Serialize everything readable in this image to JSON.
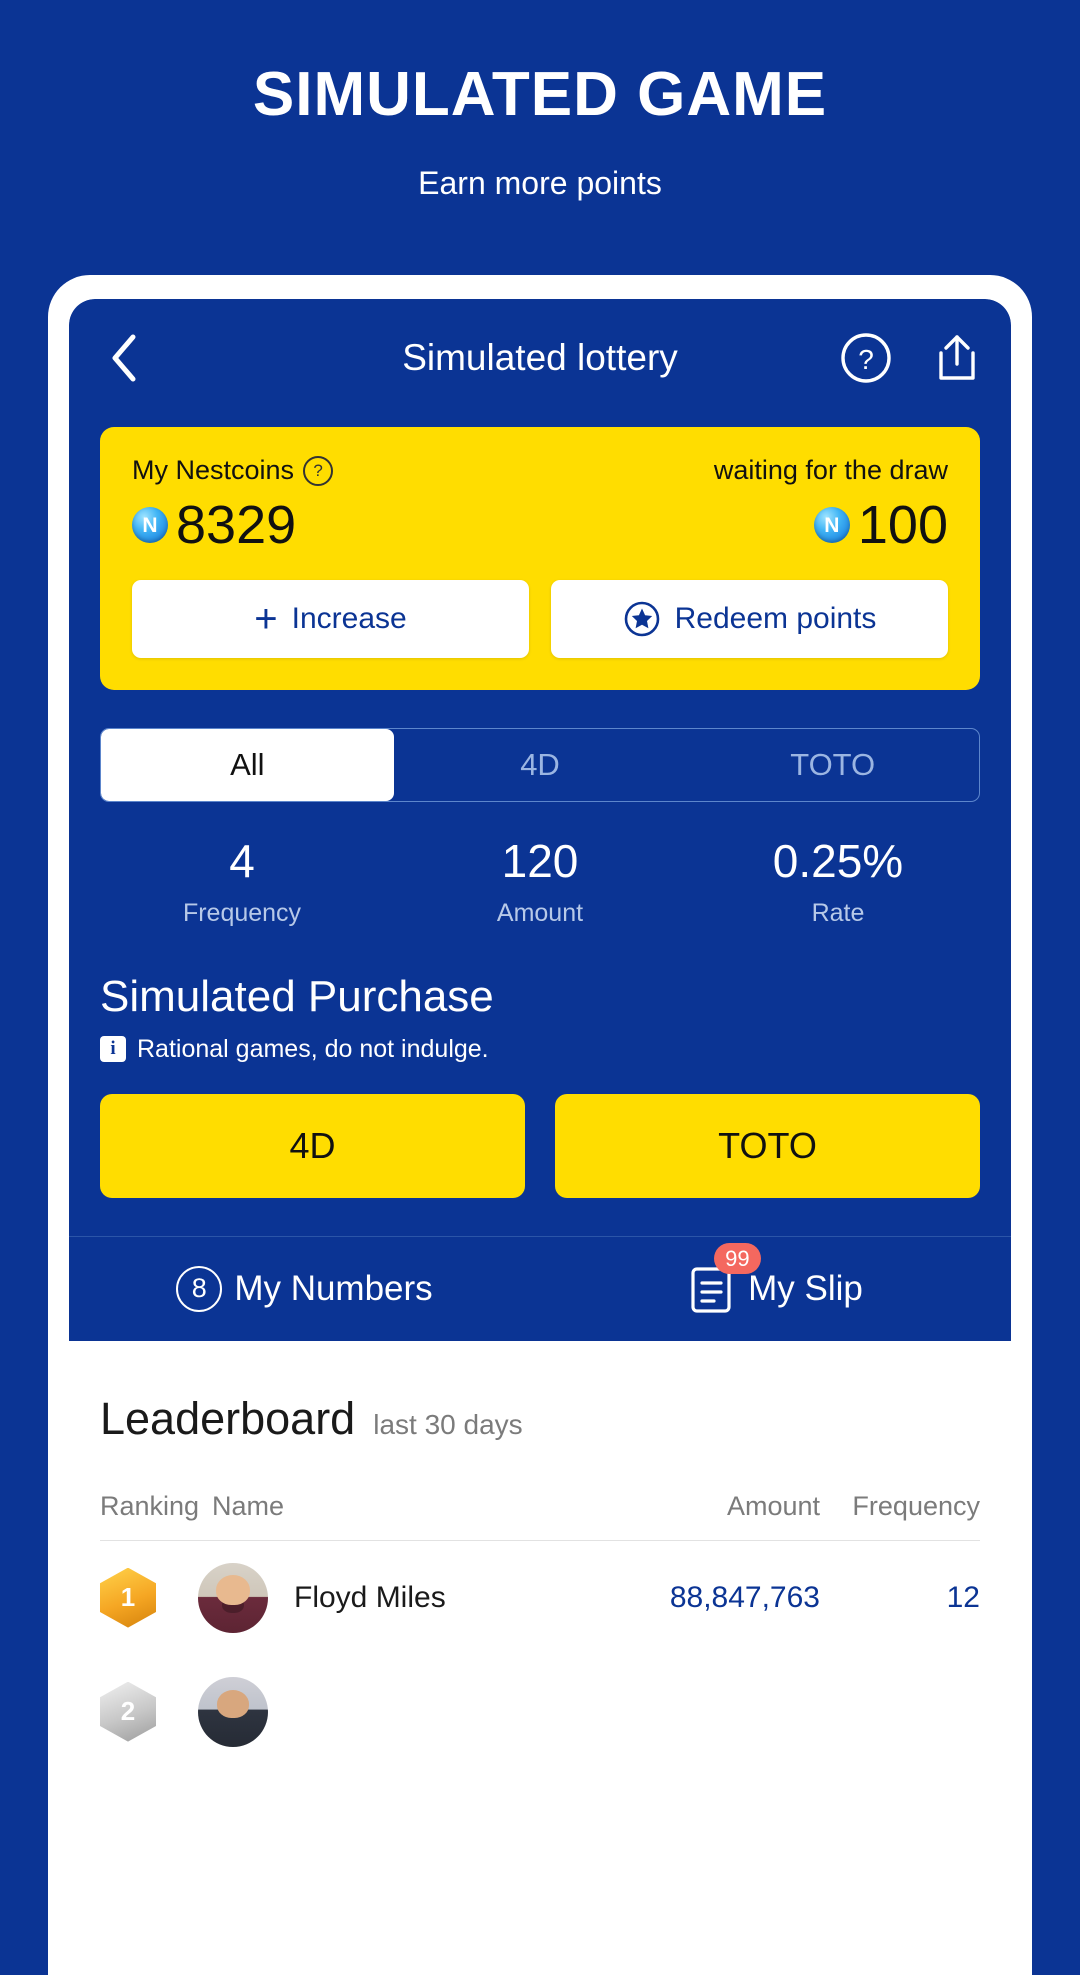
{
  "promo": {
    "title": "SIMULATED GAME",
    "subtitle": "Earn more points"
  },
  "colors": {
    "brand_blue": "#0b3494",
    "accent_yellow": "#ffdd00",
    "badge_red": "#f4685f",
    "link_blue": "#0b3494"
  },
  "nav": {
    "back_icon": "chevron-left-icon",
    "title": "Simulated lottery",
    "help_icon": "question-circle-icon",
    "share_icon": "share-upload-icon"
  },
  "coin_card": {
    "left": {
      "label": "My Nestcoins",
      "help_icon": "question-circle-icon",
      "coin_icon": "nestcoin-icon",
      "coin_symbol": "N",
      "value": "8329"
    },
    "right": {
      "label": "waiting for the draw",
      "coin_icon": "nestcoin-icon",
      "coin_symbol": "N",
      "value": "100"
    },
    "buttons": [
      {
        "label": "Increase",
        "icon": "plus-icon",
        "glyph": "+"
      },
      {
        "label": "Redeem points",
        "icon": "star-circle-icon"
      }
    ]
  },
  "tabs": [
    {
      "label": "All",
      "active": true
    },
    {
      "label": "4D",
      "active": false
    },
    {
      "label": "TOTO",
      "active": false
    }
  ],
  "stats": [
    {
      "value": "4",
      "label": "Frequency"
    },
    {
      "value": "120",
      "label": "Amount"
    },
    {
      "value": "0.25%",
      "label": "Rate"
    }
  ],
  "purchase": {
    "title": "Simulated Purchase",
    "note": "Rational games, do not indulge.",
    "note_icon": "info-icon",
    "note_glyph": "i",
    "buttons": [
      {
        "label": "4D"
      },
      {
        "label": "TOTO"
      }
    ]
  },
  "bottom_bar": {
    "my_numbers": {
      "label": "My Numbers",
      "count": "8",
      "icon": "numbered-circle-icon"
    },
    "my_slip": {
      "label": "My Slip",
      "badge": "99",
      "icon": "document-list-icon"
    }
  },
  "leaderboard": {
    "title": "Leaderboard",
    "subtitle": "last 30 days",
    "columns": {
      "ranking": "Ranking",
      "name": "Name",
      "amount": "Amount",
      "frequency": "Frequency"
    },
    "rows": [
      {
        "rank": "1",
        "name": "Floyd Miles",
        "amount": "88,847,763",
        "frequency": "12"
      },
      {
        "rank": "2",
        "name": "",
        "amount": "",
        "frequency": ""
      }
    ]
  }
}
